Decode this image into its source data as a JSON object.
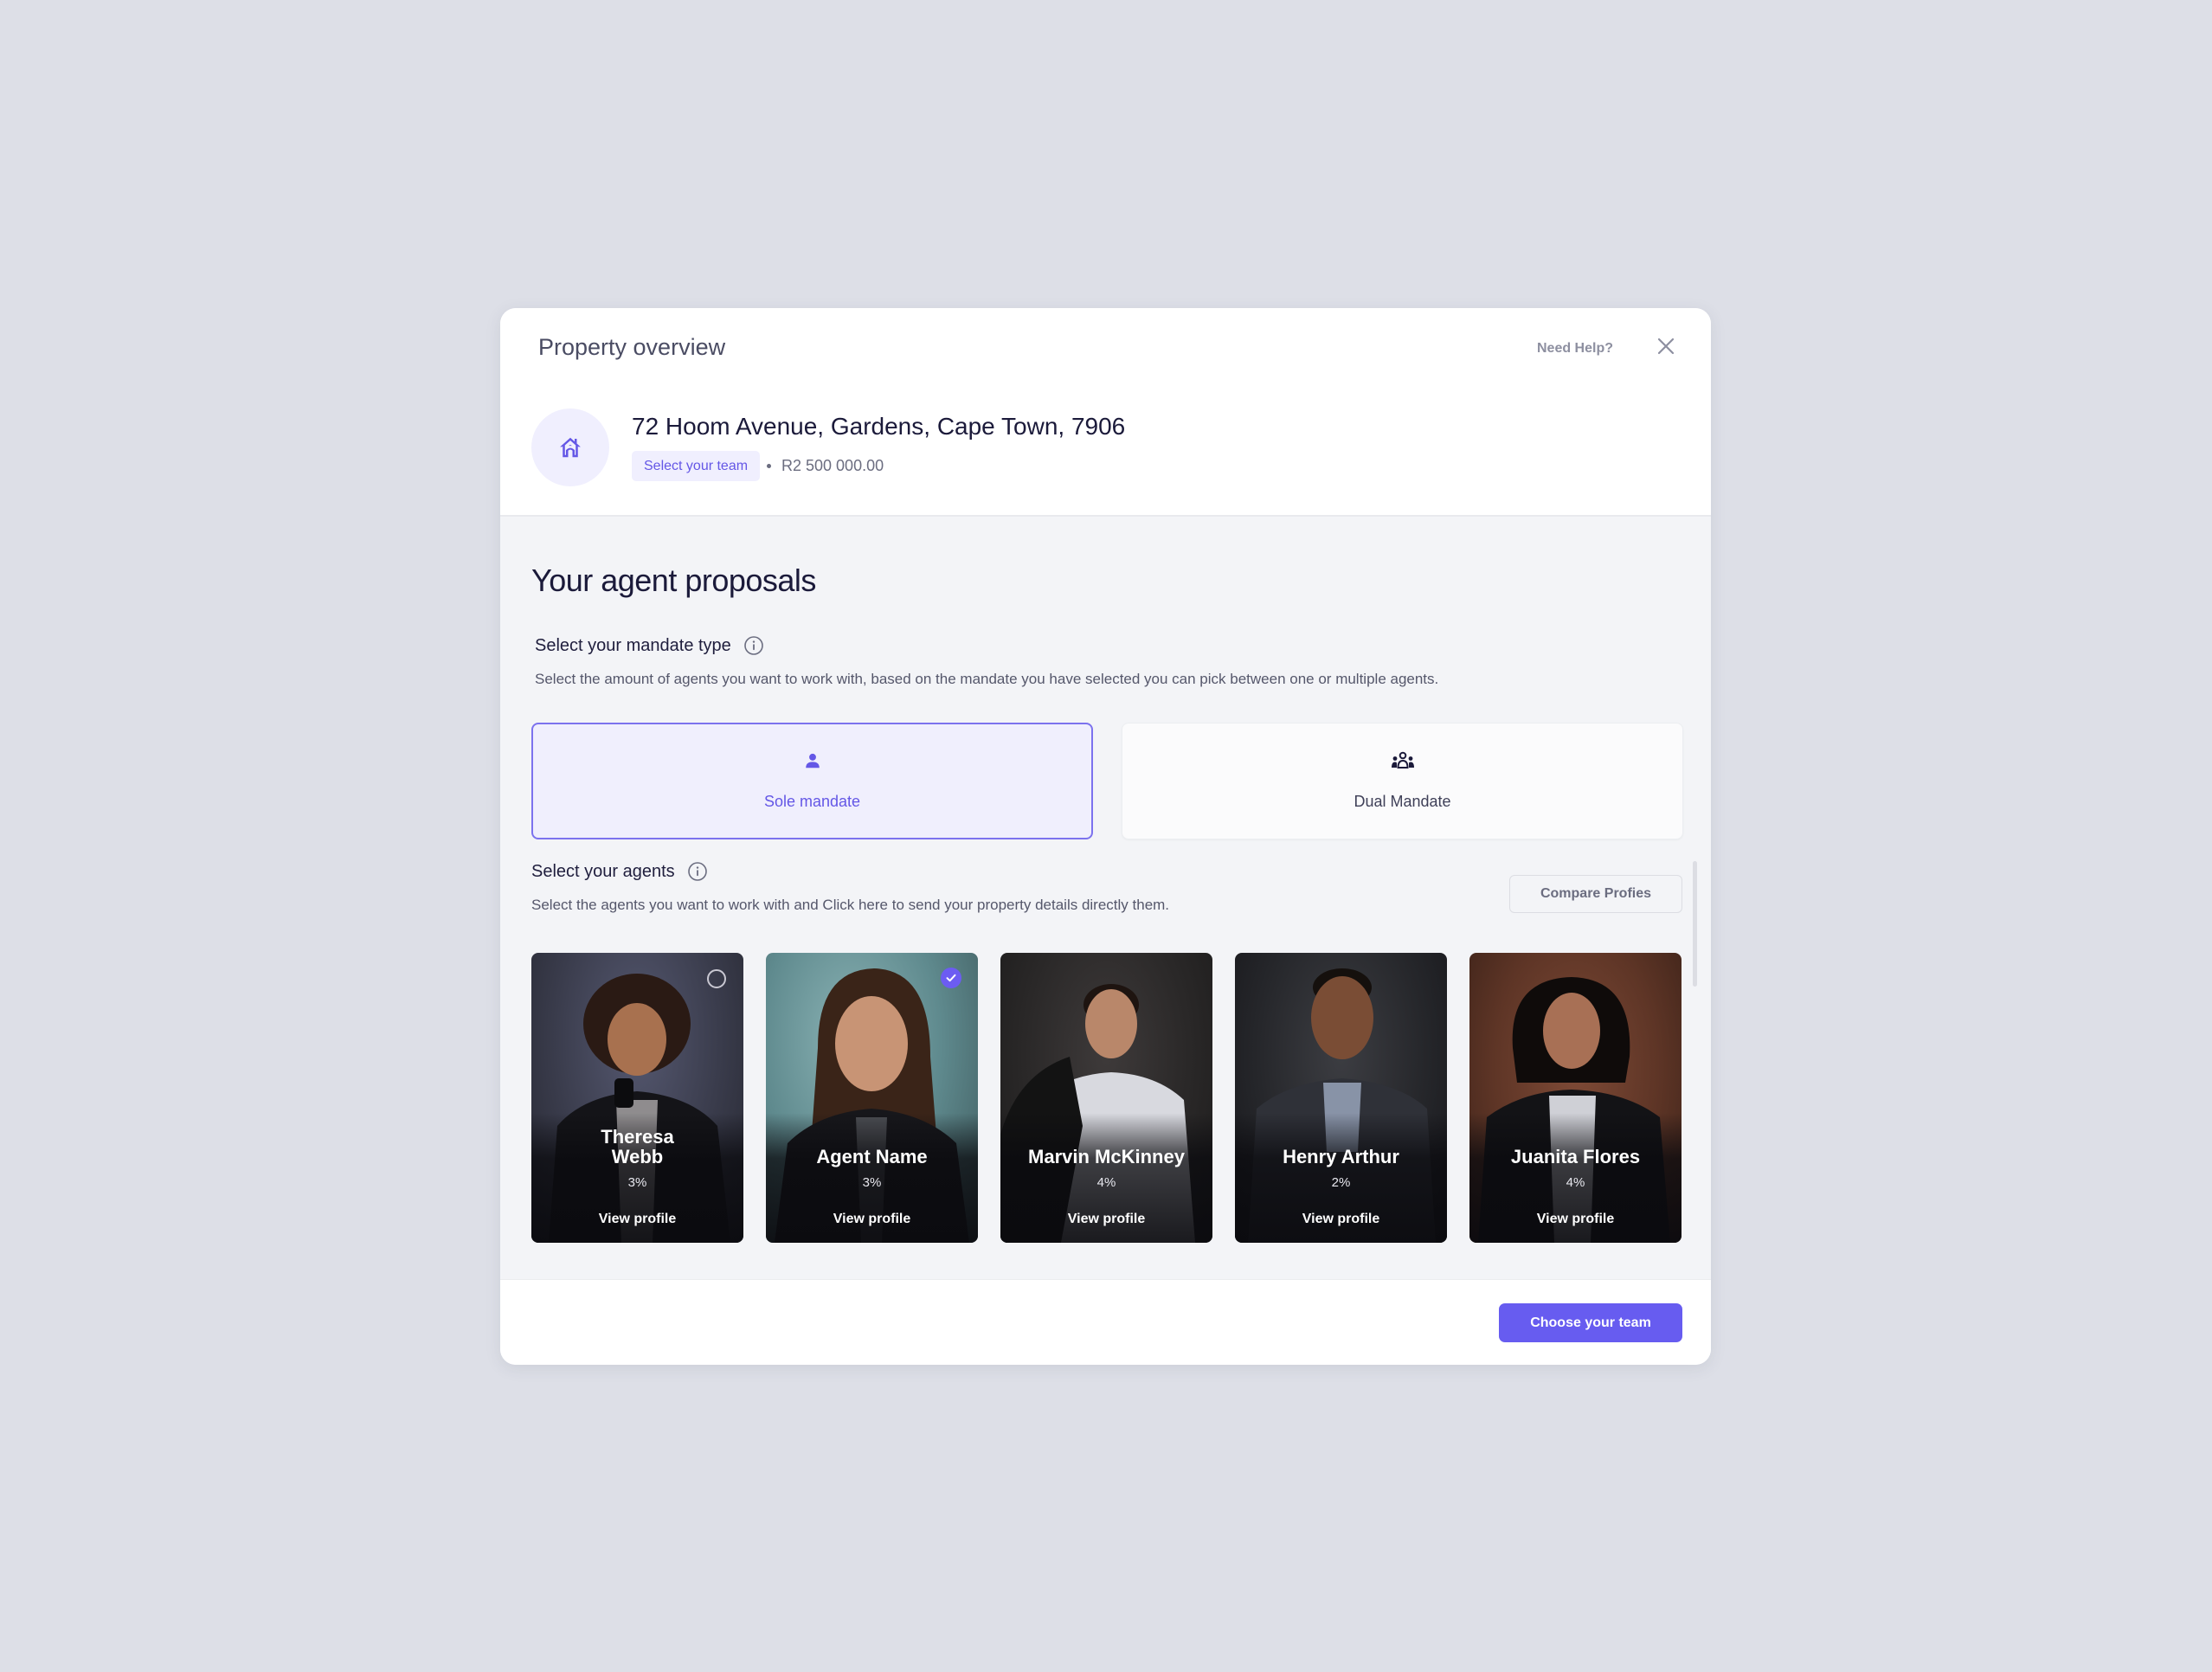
{
  "modal": {
    "title": "Property overview",
    "need_help": "Need Help?",
    "close_icon": "close-icon"
  },
  "property": {
    "icon": "house-icon",
    "address": "72 Hoom Avenue, Gardens, Cape Town, 7906",
    "status_badge": "Select your team",
    "price": "R2 500 000.00"
  },
  "proposals": {
    "title": "Your agent proposals",
    "mandate": {
      "label": "Select your mandate type",
      "description": "Select the amount of agents you want to work with, based on the mandate you have selected you can pick between one or multiple agents.",
      "options": [
        {
          "label": "Sole mandate",
          "icon": "person-icon",
          "selected": true
        },
        {
          "label": "Dual Mandate",
          "icon": "group-icon",
          "selected": false
        }
      ]
    },
    "agents_section": {
      "label": "Select your agents",
      "description": "Select the agents you want to work with and Click here to send your property details directly them.",
      "compare_button": "Compare Profies"
    },
    "agents": [
      {
        "name": "Theresa Webb",
        "rate": "3%",
        "link": "View profile",
        "selector": "unchecked"
      },
      {
        "name": "Agent Name",
        "rate": "3%",
        "link": "View profile",
        "selector": "checked"
      },
      {
        "name": "Marvin McKinney",
        "rate": "4%",
        "link": "View profile",
        "selector": "none"
      },
      {
        "name": "Henry Arthur",
        "rate": "2%",
        "link": "View profile",
        "selector": "none"
      },
      {
        "name": "Juanita Flores",
        "rate": "4%",
        "link": "View profile",
        "selector": "none"
      }
    ]
  },
  "footer": {
    "primary_button": "Choose your team"
  },
  "colors": {
    "accent": "#675cf0",
    "accent_light": "#f0effe",
    "page_bg": "#dddfe7",
    "body_bg": "#f3f4f7",
    "text_dark": "#1b1a3a"
  }
}
